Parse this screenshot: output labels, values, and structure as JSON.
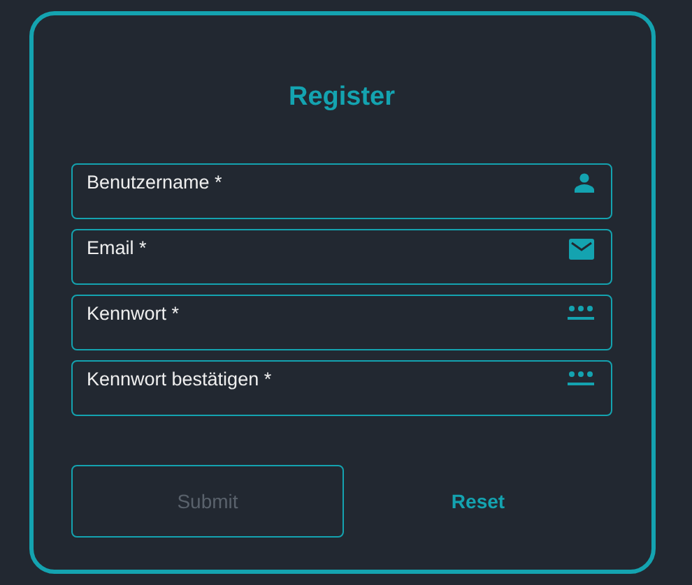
{
  "title": "Register",
  "fields": [
    {
      "placeholder": "Benutzername *",
      "kind": "user"
    },
    {
      "placeholder": "Email *",
      "kind": "email"
    },
    {
      "placeholder": "Kennwort *",
      "kind": "password"
    },
    {
      "placeholder": "Kennwort bestätigen *",
      "kind": "password"
    }
  ],
  "submit": {
    "label": "Submit",
    "disabled": true
  },
  "reset": {
    "label": "Reset"
  }
}
